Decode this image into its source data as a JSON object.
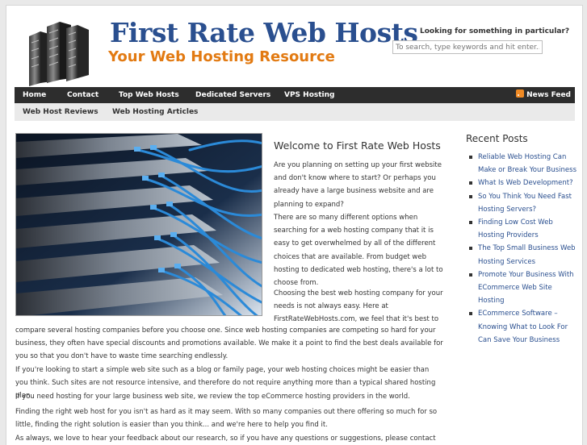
{
  "header": {
    "title": "First Rate Web Hosts",
    "tagline": "Your Web Hosting Resource",
    "search_label": "Looking for something in particular?",
    "search_placeholder": "To search, type keywords and hit enter..."
  },
  "nav_primary": {
    "items": [
      {
        "label": "Home"
      },
      {
        "label": "Contact"
      },
      {
        "label": "Top Web Hosts"
      },
      {
        "label": "Dedicated Servers"
      },
      {
        "label": "VPS Hosting"
      }
    ],
    "rss_label": "News Feed"
  },
  "nav_secondary": {
    "items": [
      {
        "label": "Web Host Reviews"
      },
      {
        "label": "Web Hosting Articles"
      }
    ]
  },
  "main": {
    "title": "Welcome to First Rate Web Hosts",
    "paragraphs": [
      "Are you planning on setting up your first website and don't know where to start? Or perhaps you already have a large business website and are planning to expand?",
      "There are so many different options when searching for a web hosting company that it is easy to get overwhelmed by all of the different choices that are available. From budget web hosting to dedicated web hosting, there's a lot to choose from.",
      "Choosing the best web hosting company for your needs is not always easy. Here at FirstRateWebHosts.com, we feel that it's best to",
      "compare several hosting companies before you choose one. Since web hosting companies are competing so hard for your business, they often have special discounts and promotions available. We make it a point to find the best deals available for you so that you don't have to waste time searching endlessly.",
      "If you're looking to start a simple web site such as a blog or family page, your web hosting choices might be easier than you think. Such sites are not resource intensive, and therefore do not require anything more than a typical shared hosting plan.",
      "If you need hosting for your large business web site, we review the top eCommerce hosting providers in the world.",
      "Finding the right web host for you isn't as hard as it may seem. With so many companies out there offering so much for so little, finding the right solution is easier than you think... and we're here to help you find it.",
      "As always, we love to hear your feedback about our research, so if you have any questions or suggestions, please contact us or"
    ]
  },
  "sidebar": {
    "title": "Recent Posts",
    "posts": [
      "Reliable Web Hosting Can Make or Break Your Business",
      "What Is Web Development?",
      "So You Think You Need Fast Hosting Servers?",
      "Finding Low Cost Web Hosting Providers",
      "The Top Small Business Web Hosting Services",
      "Promote Your Business With ECommerce Web Site Hosting",
      "ECommerce Software – Knowing What to Look For Can Save Your Business"
    ]
  },
  "colors": {
    "brand_blue": "#2a4f8f",
    "brand_orange": "#e27a12",
    "nav_bg": "#2d2d2d",
    "subnav_bg": "#eaeaea"
  }
}
